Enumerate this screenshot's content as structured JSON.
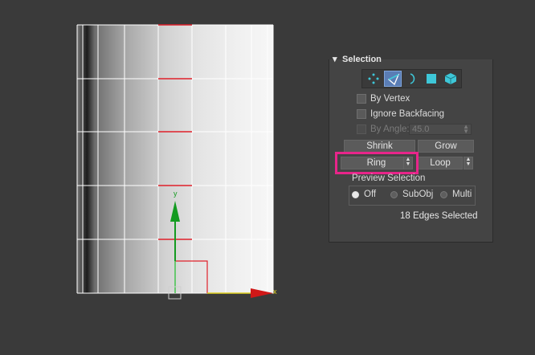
{
  "viewport": {
    "axis_y_label": "y",
    "axis_x_label": "x"
  },
  "selection_rollout": {
    "title": "Selection",
    "modes": [
      {
        "name": "vertex-icon",
        "active": false
      },
      {
        "name": "edge-icon",
        "active": true
      },
      {
        "name": "border-icon",
        "active": false
      },
      {
        "name": "polygon-icon",
        "active": false
      },
      {
        "name": "element-icon",
        "active": false
      }
    ],
    "by_vertex": "By Vertex",
    "ignore_backfacing": "Ignore Backfacing",
    "by_angle": "By Angle:",
    "angle_value": "45.0",
    "shrink": "Shrink",
    "grow": "Grow",
    "ring": "Ring",
    "loop": "Loop",
    "preview_selection": "Preview Selection",
    "preview_options": [
      "Off",
      "SubObj",
      "Multi"
    ],
    "preview_selected": "Off",
    "status": "18 Edges Selected"
  },
  "colors": {
    "selected_edge": "#e0202a",
    "highlight_box": "#e8258a",
    "active_mode": "#5a7db5"
  }
}
